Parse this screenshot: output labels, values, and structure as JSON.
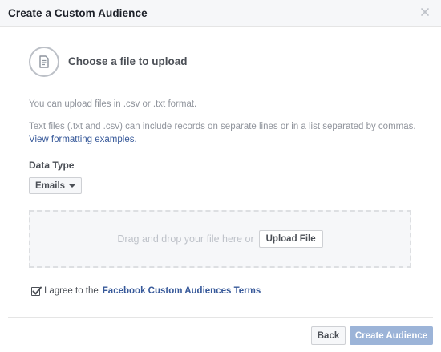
{
  "dialog": {
    "title": "Create a Custom Audience",
    "close_icon": "close-icon"
  },
  "upload": {
    "icon": "document-icon",
    "heading": "Choose a file to upload",
    "format_note": "You can upload files in .csv or .txt format.",
    "records_note": "Text files (.txt and .csv) can include records on separate lines or in a list separated by commas.",
    "formatting_link": "View formatting examples."
  },
  "data_type": {
    "label": "Data Type",
    "selected": "Emails"
  },
  "dropzone": {
    "text": "Drag and drop your file here or",
    "upload_button": "Upload File"
  },
  "terms": {
    "checked": true,
    "prefix": "I agree to the",
    "link": "Facebook Custom Audiences Terms"
  },
  "footer": {
    "back_label": "Back",
    "create_label": "Create Audience"
  },
  "colors": {
    "link": "#365899",
    "create_button_disabled": "#9cb4d8"
  }
}
